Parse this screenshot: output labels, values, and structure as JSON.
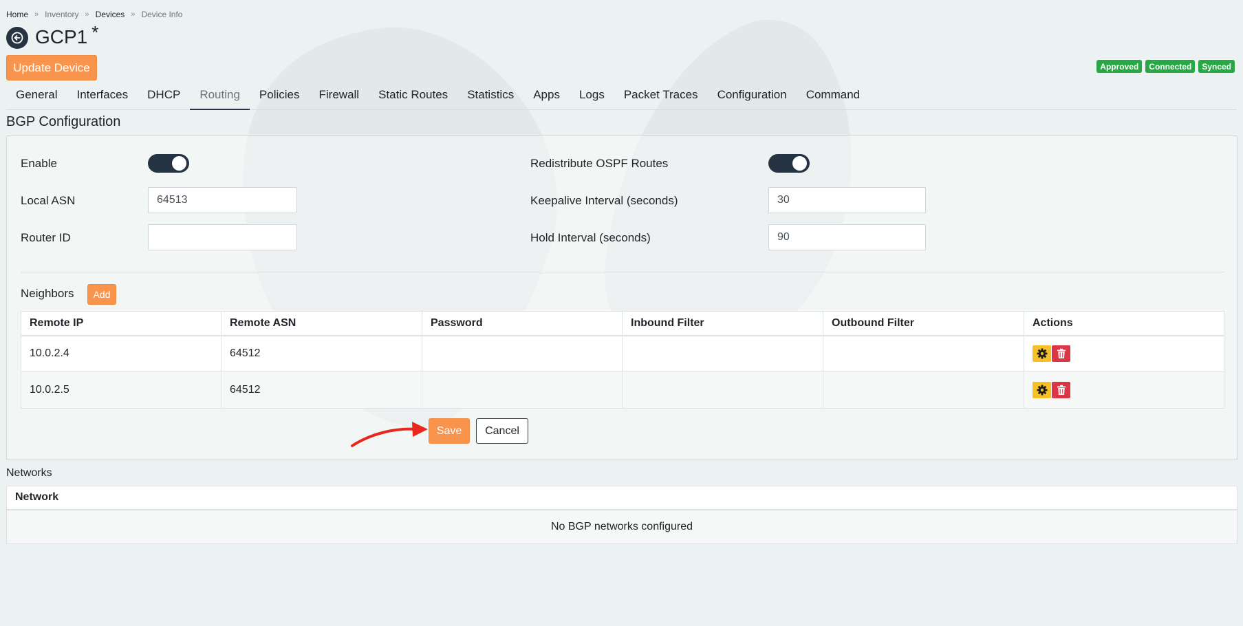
{
  "breadcrumb": [
    "Home",
    "Inventory",
    "Devices",
    "Device Info"
  ],
  "breadcrumb_separator": "»",
  "title": "GCP1",
  "title_suffix": "*",
  "update_button": "Update Device",
  "badges": [
    "Approved",
    "Connected",
    "Synced"
  ],
  "tabs": [
    "General",
    "Interfaces",
    "DHCP",
    "Routing",
    "Policies",
    "Firewall",
    "Static Routes",
    "Statistics",
    "Apps",
    "Logs",
    "Packet Traces",
    "Configuration",
    "Command"
  ],
  "active_tab": "Routing",
  "section_title": "BGP Configuration",
  "form": {
    "enable_label": "Enable",
    "enable_on": true,
    "local_asn_label": "Local ASN",
    "local_asn_value": "64513",
    "router_id_label": "Router ID",
    "router_id_value": "",
    "redistribute_label": "Redistribute OSPF Routes",
    "redistribute_on": true,
    "keepalive_label": "Keepalive Interval (seconds)",
    "keepalive_value": "30",
    "hold_label": "Hold Interval (seconds)",
    "hold_value": "90"
  },
  "neighbors": {
    "label": "Neighbors",
    "add_button": "Add",
    "columns": [
      "Remote IP",
      "Remote ASN",
      "Password",
      "Inbound Filter",
      "Outbound Filter",
      "Actions"
    ],
    "rows": [
      {
        "remote_ip": "10.0.2.4",
        "remote_asn": "64512",
        "password": "",
        "inbound": "",
        "outbound": ""
      },
      {
        "remote_ip": "10.0.2.5",
        "remote_asn": "64512",
        "password": "",
        "inbound": "",
        "outbound": ""
      }
    ]
  },
  "save_button": "Save",
  "cancel_button": "Cancel",
  "networks": {
    "label": "Networks",
    "column": "Network",
    "empty_text": "No BGP networks configured"
  },
  "colors": {
    "accent": "#f9944d",
    "dark": "#253342",
    "badge": "#28a745",
    "edit": "#f6c026",
    "delete": "#dc3545",
    "arrow": "#e8281e"
  }
}
